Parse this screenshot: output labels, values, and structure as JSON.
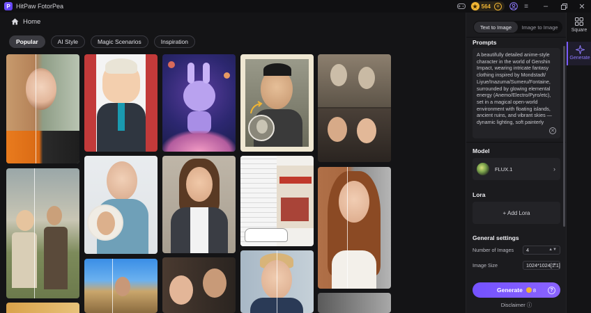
{
  "app": {
    "title": "HitPaw FotorPea",
    "coins": "564"
  },
  "nav": {
    "home_label": "Home"
  },
  "tabs": [
    {
      "label": "Popular",
      "active": true
    },
    {
      "label": "AI Style",
      "active": false
    },
    {
      "label": "Magic Scenarios",
      "active": false
    },
    {
      "label": "Inspiration",
      "active": false
    }
  ],
  "panel": {
    "mode_tabs": [
      {
        "label": "Text to Image",
        "active": true
      },
      {
        "label": "Image to Image",
        "active": false
      }
    ],
    "prompts_label": "Prompts",
    "prompt_text": "A beautifully detailed anime-style character in the world of Genshin Impact, wearing intricate fantasy clothing inspired by Mondstadt/ Liyue/Inazuma/Sumeru/Fontaine, surrounded by glowing elemental energy (Anemo/Electro/Pyro/etc), set in a magical open-world environment with floating islands, ancient ruins, and vibrant skies — dynamic lighting, soft painterly",
    "model_label": "Model",
    "model_name": "FLUX.1",
    "lora_label": "Lora",
    "add_lora_label": "+ Add Lora",
    "general_label": "General settings",
    "num_images_label": "Number of Images",
    "num_images_value": "4",
    "image_size_label": "Image Size",
    "image_size_value": "1024*1024[1:1]",
    "generate_label": "Generate",
    "generate_cost": "8",
    "disclaimer_label": "Disclaimer"
  },
  "rail": [
    {
      "label": "Square",
      "icon": "grid-icon",
      "active": false
    },
    {
      "label": "Generate",
      "icon": "sparkle-icon",
      "active": true
    }
  ],
  "colors": {
    "accent": "#7452ff",
    "coin": "#f1b533",
    "background": "#141416",
    "panel": "#1b1b1e"
  }
}
